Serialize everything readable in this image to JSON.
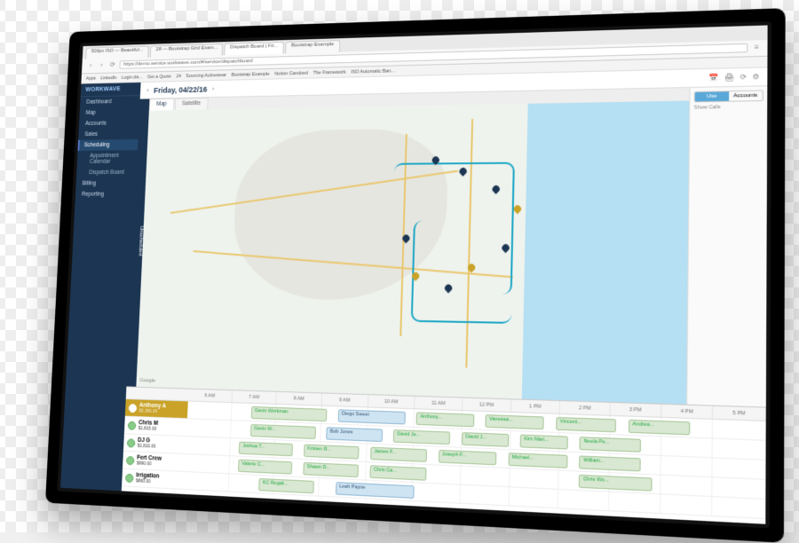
{
  "browser": {
    "tabs": [
      "500px ISO — Beautiful...",
      "28 — Bootstrap Grid Exam...",
      "Dispatch Board | Fri...",
      "Bootstrap Example"
    ],
    "active_tab": 2,
    "url": "https://demo.service.workwave.com/#/service/dispatchboard",
    "bookmarks": [
      "Apps",
      "LinkedIn",
      "Login dis...",
      "Get a Quote",
      "24",
      "Sourcing Activewear",
      "Bootstrap Example",
      "Notion Candoed",
      "The Framework",
      "ISO Automatic Ban..."
    ]
  },
  "brand": "WORKWAVE",
  "sidebar": {
    "items": [
      {
        "label": "Dashboard"
      },
      {
        "label": "Map"
      },
      {
        "label": "Accounts"
      },
      {
        "label": "Sales"
      },
      {
        "label": "Scheduling",
        "selected": true
      },
      {
        "label": "Appointment Calendar",
        "sub": true
      },
      {
        "label": "Dispatch Board",
        "sub": true
      },
      {
        "label": "Billing"
      },
      {
        "label": "Reporting"
      }
    ]
  },
  "page": {
    "title": "Friday, 04/22/16",
    "map_tabs": [
      "Map",
      "Satellite"
    ],
    "unscheduled_label": "Unscheduled",
    "map_attrib": "Google"
  },
  "rightpanel": {
    "view": [
      "Use",
      "Accounts"
    ],
    "small": "Show Calls"
  },
  "timeline": {
    "hours": [
      "6 AM",
      "7 AM",
      "8 AM",
      "9 AM",
      "10 AM",
      "11 AM",
      "12 PM",
      "1 PM",
      "2 PM",
      "3 PM",
      "4 PM",
      "5 PM"
    ],
    "techs": [
      {
        "name": "Anthony A",
        "amount": "$2,360.00",
        "selected": true
      },
      {
        "name": "Chris M",
        "amount": "$1,815.00"
      },
      {
        "name": "DJ G",
        "amount": "$1,810.00"
      },
      {
        "name": "Fert Crew",
        "amount": "$990.00"
      },
      {
        "name": "Irrigation",
        "amount": "$860.00"
      }
    ],
    "rows": [
      [
        {
          "l": 12,
          "w": 14,
          "t": "Gavin Workman"
        },
        {
          "l": 28,
          "w": 12,
          "t": "Diego Sweet",
          "c": "b"
        },
        {
          "l": 42,
          "w": 10,
          "t": "Anthony..."
        },
        {
          "l": 54,
          "w": 10,
          "t": "Vanessa..."
        },
        {
          "l": 66,
          "w": 10,
          "t": "Vincent..."
        },
        {
          "l": 78,
          "w": 10,
          "t": "Andrea..."
        }
      ],
      [
        {
          "l": 12,
          "w": 12,
          "t": "Gavin W..."
        },
        {
          "l": 26,
          "w": 10,
          "t": "Bob Jones",
          "c": "b"
        },
        {
          "l": 38,
          "w": 10,
          "t": "David Je..."
        },
        {
          "l": 50,
          "w": 8,
          "t": "David J..."
        },
        {
          "l": 60,
          "w": 8,
          "t": "Kim Mari..."
        },
        {
          "l": 70,
          "w": 10,
          "t": "Neela Pe..."
        }
      ],
      [
        {
          "l": 10,
          "w": 10,
          "t": "Joshua T..."
        },
        {
          "l": 22,
          "w": 10,
          "t": "Kristen R..."
        },
        {
          "l": 34,
          "w": 10,
          "t": "James F..."
        },
        {
          "l": 46,
          "w": 10,
          "t": "Joseph F..."
        },
        {
          "l": 58,
          "w": 10,
          "t": "Michael..."
        },
        {
          "l": 70,
          "w": 10,
          "t": "William..."
        }
      ],
      [
        {
          "l": 10,
          "w": 10,
          "t": "Valerie C..."
        },
        {
          "l": 22,
          "w": 10,
          "t": "Shawn D..."
        },
        {
          "l": 34,
          "w": 10,
          "t": "Chris Ca..."
        },
        {
          "l": 70,
          "w": 12,
          "t": "Chris Wo..."
        }
      ],
      [
        {
          "l": 14,
          "w": 10,
          "t": "KC Regali..."
        },
        {
          "l": 28,
          "w": 14,
          "t": "Leah Payne",
          "c": "b"
        }
      ]
    ]
  }
}
